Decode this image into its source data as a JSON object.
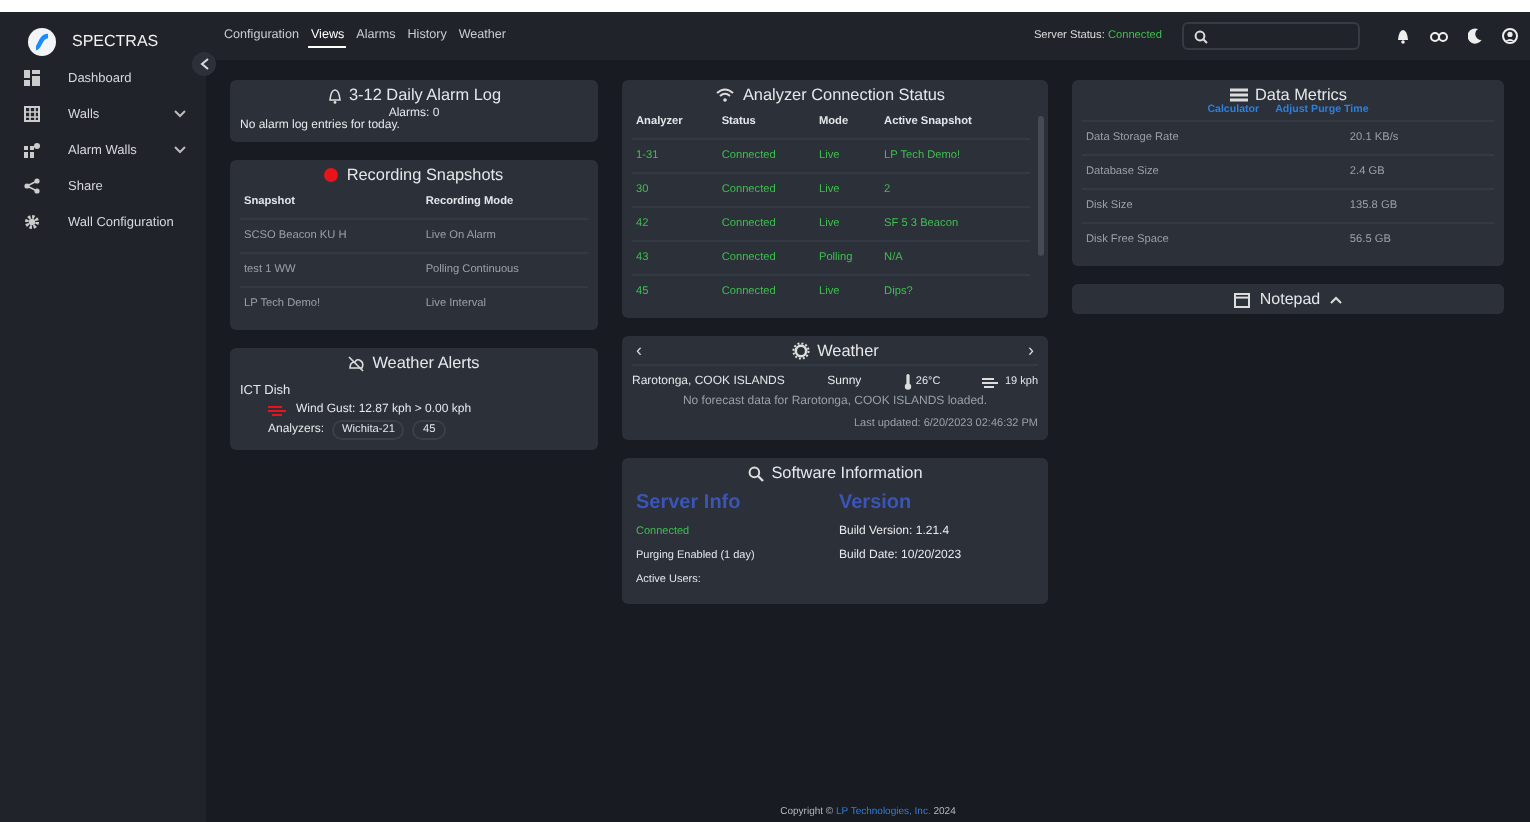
{
  "brand": "SPECTRAS",
  "sidebar": {
    "items": [
      {
        "label": "Dashboard",
        "kind": "dashboard",
        "expandable": false
      },
      {
        "label": "Walls",
        "kind": "grid",
        "expandable": true
      },
      {
        "label": "Alarm Walls",
        "kind": "alarm",
        "expandable": true
      },
      {
        "label": "Share",
        "kind": "share",
        "expandable": false
      },
      {
        "label": "Wall Configuration",
        "kind": "settings",
        "expandable": false
      }
    ]
  },
  "nav": {
    "tabs": [
      {
        "label": "Configuration",
        "selected": false
      },
      {
        "label": "Views",
        "selected": true
      },
      {
        "label": "Alarms",
        "selected": false
      },
      {
        "label": "History",
        "selected": false
      },
      {
        "label": "Weather",
        "selected": false
      }
    ]
  },
  "server_status": {
    "label": "Server Status:",
    "value": "Connected"
  },
  "alarm_log": {
    "title": "3-12 Daily Alarm Log",
    "count": "Alarms: 0",
    "message": "No alarm log entries for today."
  },
  "recording": {
    "title": "Recording Snapshots",
    "columns": [
      "Snapshot",
      "Recording Mode"
    ],
    "rows": [
      [
        "SCSO Beacon KU H",
        "Live On Alarm"
      ],
      [
        "test 1 WW",
        "Polling Continuous"
      ],
      [
        "LP Tech Demo!",
        "Live Interval"
      ]
    ]
  },
  "weather_alerts": {
    "title": "Weather Alerts",
    "site": "ICT Dish",
    "alert": "Wind Gust: 12.87 kph > 0.00 kph",
    "analyzers_label": "Analyzers:",
    "analyzers": [
      "Wichita-21",
      "45"
    ]
  },
  "analyzers": {
    "title": "Analyzer Connection Status",
    "columns": [
      "Analyzer",
      "Status",
      "Mode",
      "Active Snapshot"
    ],
    "rows": [
      [
        "1-31",
        "Connected",
        "Live",
        "LP Tech Demo!"
      ],
      [
        "30",
        "Connected",
        "Live",
        "2"
      ],
      [
        "42",
        "Connected",
        "Live",
        "SF 5 3 Beacon"
      ],
      [
        "43",
        "Connected",
        "Polling",
        "N/A"
      ],
      [
        "45",
        "Connected",
        "Live",
        "Dips?"
      ]
    ]
  },
  "weather": {
    "title": "Weather",
    "prev": "‹",
    "next": "›",
    "location": "Rarotonga, COOK ISLANDS",
    "condition": "Sunny",
    "temperature": "26°C",
    "wind": "19 kph",
    "message": "No forecast data for Rarotonga, COOK ISLANDS loaded.",
    "updated": "Last updated: 6/20/2023 02:46:32 PM"
  },
  "software": {
    "title": "Software Information",
    "server_heading": "Server Info",
    "version_heading": "Version",
    "server_lines": [
      {
        "text": "Connected",
        "kind": "status"
      },
      {
        "text": "Purging Enabled (1 day)",
        "kind": "plain"
      },
      {
        "text": "Active Users:",
        "kind": "plain"
      }
    ],
    "version_lines": [
      "Build Version: 1.21.4",
      "Build Date: 10/20/2023"
    ]
  },
  "metrics": {
    "title": "Data Metrics",
    "links": [
      "Calculator",
      "Adjust Purge Time"
    ],
    "rows": [
      [
        "Data Storage Rate",
        "20.1 KB/s"
      ],
      [
        "Database Size",
        "2.4 GB"
      ],
      [
        "Disk Size",
        "135.8 GB"
      ],
      [
        "Disk Free Space",
        "56.5 GB"
      ]
    ]
  },
  "notepad": {
    "title": "Notepad",
    "expanded": false
  },
  "footer": {
    "prefix": "Copyright © ",
    "link": "LP Technologies, Inc.",
    "suffix": " 2024"
  }
}
